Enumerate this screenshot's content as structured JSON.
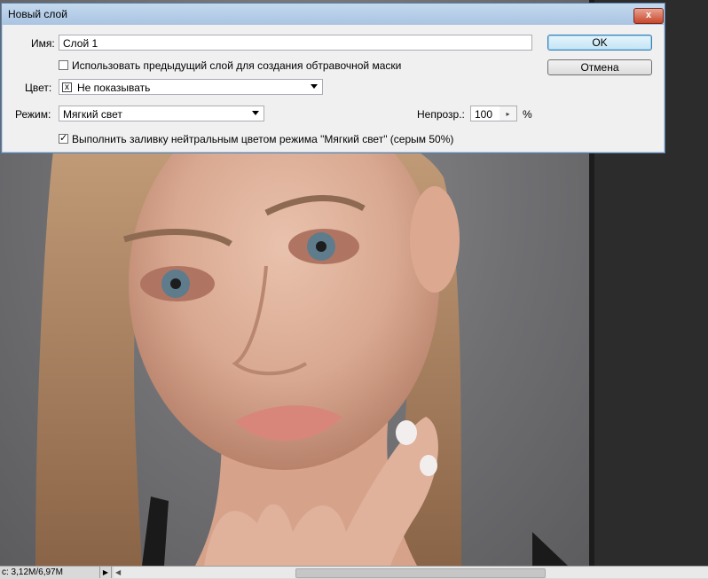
{
  "dialog": {
    "title": "Новый слой",
    "close_label": "x",
    "name_label": "Имя:",
    "name_value": "Слой 1",
    "clip_mask_label": "Использовать предыдущий слой для создания обтравочной маски",
    "clip_mask_checked": false,
    "color_label": "Цвет:",
    "color_value": "Не показывать",
    "color_swatch": "x",
    "mode_label": "Режим:",
    "mode_value": "Мягкий свет",
    "opacity_label": "Непрозр.:",
    "opacity_value": "100",
    "opacity_unit": "%",
    "fill_neutral_label": "Выполнить заливку нейтральным цветом режима \"Мягкий свет\"  (серым 50%)",
    "fill_neutral_checked": true,
    "ok_label": "OK",
    "cancel_label": "Отмена"
  },
  "statusbar": {
    "doc_size": "c: 3,12M/6,97M",
    "arrow": "▶",
    "scroll_left": "◀"
  },
  "colors": {
    "titlebar": "#b4cce8",
    "close": "#c9452b",
    "default_button": "#c4e5f6"
  }
}
